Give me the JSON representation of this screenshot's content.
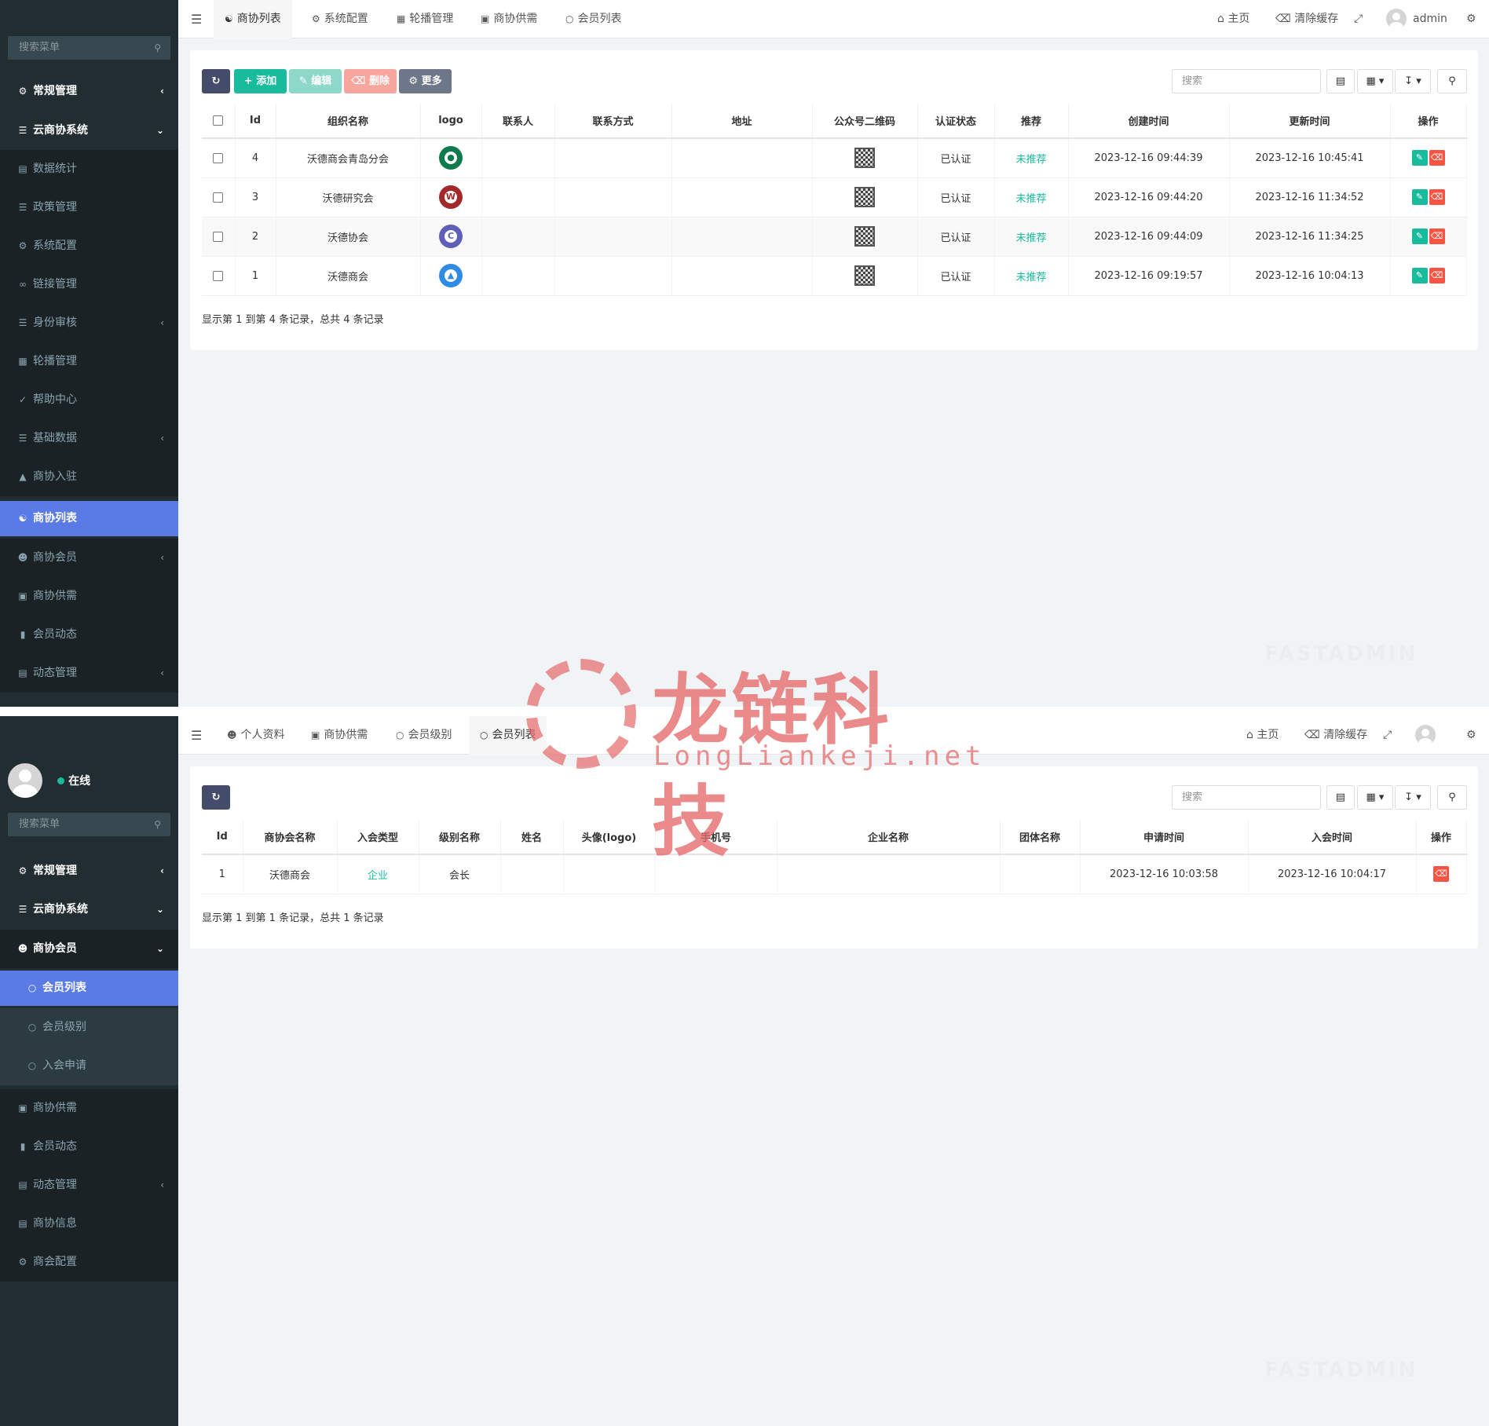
{
  "p1": {
    "sidebar": {
      "search_placeholder": "搜索菜单",
      "items": [
        {
          "label": "常规管理"
        },
        {
          "label": "云商协系统"
        },
        {
          "label": "数据统计"
        },
        {
          "label": "政策管理"
        },
        {
          "label": "系统配置"
        },
        {
          "label": "链接管理"
        },
        {
          "label": "身份审核"
        },
        {
          "label": "轮播管理"
        },
        {
          "label": "帮助中心"
        },
        {
          "label": "基础数据"
        },
        {
          "label": "商协入驻"
        },
        {
          "label": "商协列表"
        },
        {
          "label": "商协会员"
        },
        {
          "label": "商协供需"
        },
        {
          "label": "会员动态"
        },
        {
          "label": "动态管理"
        }
      ]
    },
    "tabs": [
      {
        "label": "商协列表"
      },
      {
        "label": "系统配置"
      },
      {
        "label": "轮播管理"
      },
      {
        "label": "商协供需"
      },
      {
        "label": "会员列表"
      }
    ],
    "topright": {
      "home": "主页",
      "clear_cache": "清除缓存",
      "user": "admin"
    },
    "toolbar": {
      "add": "添加",
      "edit": "编辑",
      "delete": "删除",
      "more": "更多",
      "search_placeholder": "搜索"
    },
    "table": {
      "headers": [
        "Id",
        "组织名称",
        "logo",
        "联系人",
        "联系方式",
        "地址",
        "公众号二维码",
        "认证状态",
        "推荐",
        "创建时间",
        "更新时间",
        "操作"
      ],
      "rows": [
        {
          "id": "4",
          "name": "沃德商会青岛分会",
          "status": "已认证",
          "recommend": "未推荐",
          "created": "2023-12-16 09:44:39",
          "updated": "2023-12-16 10:45:41"
        },
        {
          "id": "3",
          "name": "沃德研究会",
          "status": "已认证",
          "recommend": "未推荐",
          "created": "2023-12-16 09:44:20",
          "updated": "2023-12-16 11:34:52"
        },
        {
          "id": "2",
          "name": "沃德协会",
          "status": "已认证",
          "recommend": "未推荐",
          "created": "2023-12-16 09:44:09",
          "updated": "2023-12-16 11:34:25"
        },
        {
          "id": "1",
          "name": "沃德商会",
          "status": "已认证",
          "recommend": "未推荐",
          "created": "2023-12-16 09:19:57",
          "updated": "2023-12-16 10:04:13"
        }
      ]
    },
    "pagination": "显示第 1 到第 4 条记录，总共 4 条记录"
  },
  "p2": {
    "user": {
      "status": "在线"
    },
    "sidebar": {
      "search_placeholder": "搜索菜单",
      "items": [
        {
          "label": "常规管理"
        },
        {
          "label": "云商协系统"
        },
        {
          "label": "商协会员"
        },
        {
          "label": "会员列表"
        },
        {
          "label": "会员级别"
        },
        {
          "label": "入会申请"
        },
        {
          "label": "商协供需"
        },
        {
          "label": "会员动态"
        },
        {
          "label": "动态管理"
        },
        {
          "label": "商协信息"
        },
        {
          "label": "商会配置"
        }
      ]
    },
    "tabs": [
      {
        "label": "个人资料"
      },
      {
        "label": "商协供需"
      },
      {
        "label": "会员级别"
      },
      {
        "label": "会员列表"
      }
    ],
    "topright": {
      "home": "主页",
      "clear_cache": "清除缓存"
    },
    "toolbar": {
      "search_placeholder": "搜索"
    },
    "table": {
      "headers": [
        "Id",
        "商协会名称",
        "入会类型",
        "级别名称",
        "姓名",
        "头像(logo)",
        "手机号",
        "企业名称",
        "团体名称",
        "申请时间",
        "入会时间",
        "操作"
      ],
      "rows": [
        {
          "id": "1",
          "assoc": "沃德商会",
          "type": "企业",
          "level": "会长",
          "applied": "2023-12-16 10:03:58",
          "joined": "2023-12-16 10:04:17"
        }
      ]
    },
    "pagination": "显示第 1 到第 1 条记录，总共 1 条记录"
  },
  "watermark": {
    "title": "龙链科技",
    "url": "LongLiankeji.net"
  },
  "brand_watermark": "FASTADMIN",
  "colors": {
    "sidebar": "#222d32",
    "active": "#5a7ae6",
    "green": "#18bc9c",
    "red": "#f75444",
    "dark_btn": "#444c69"
  }
}
